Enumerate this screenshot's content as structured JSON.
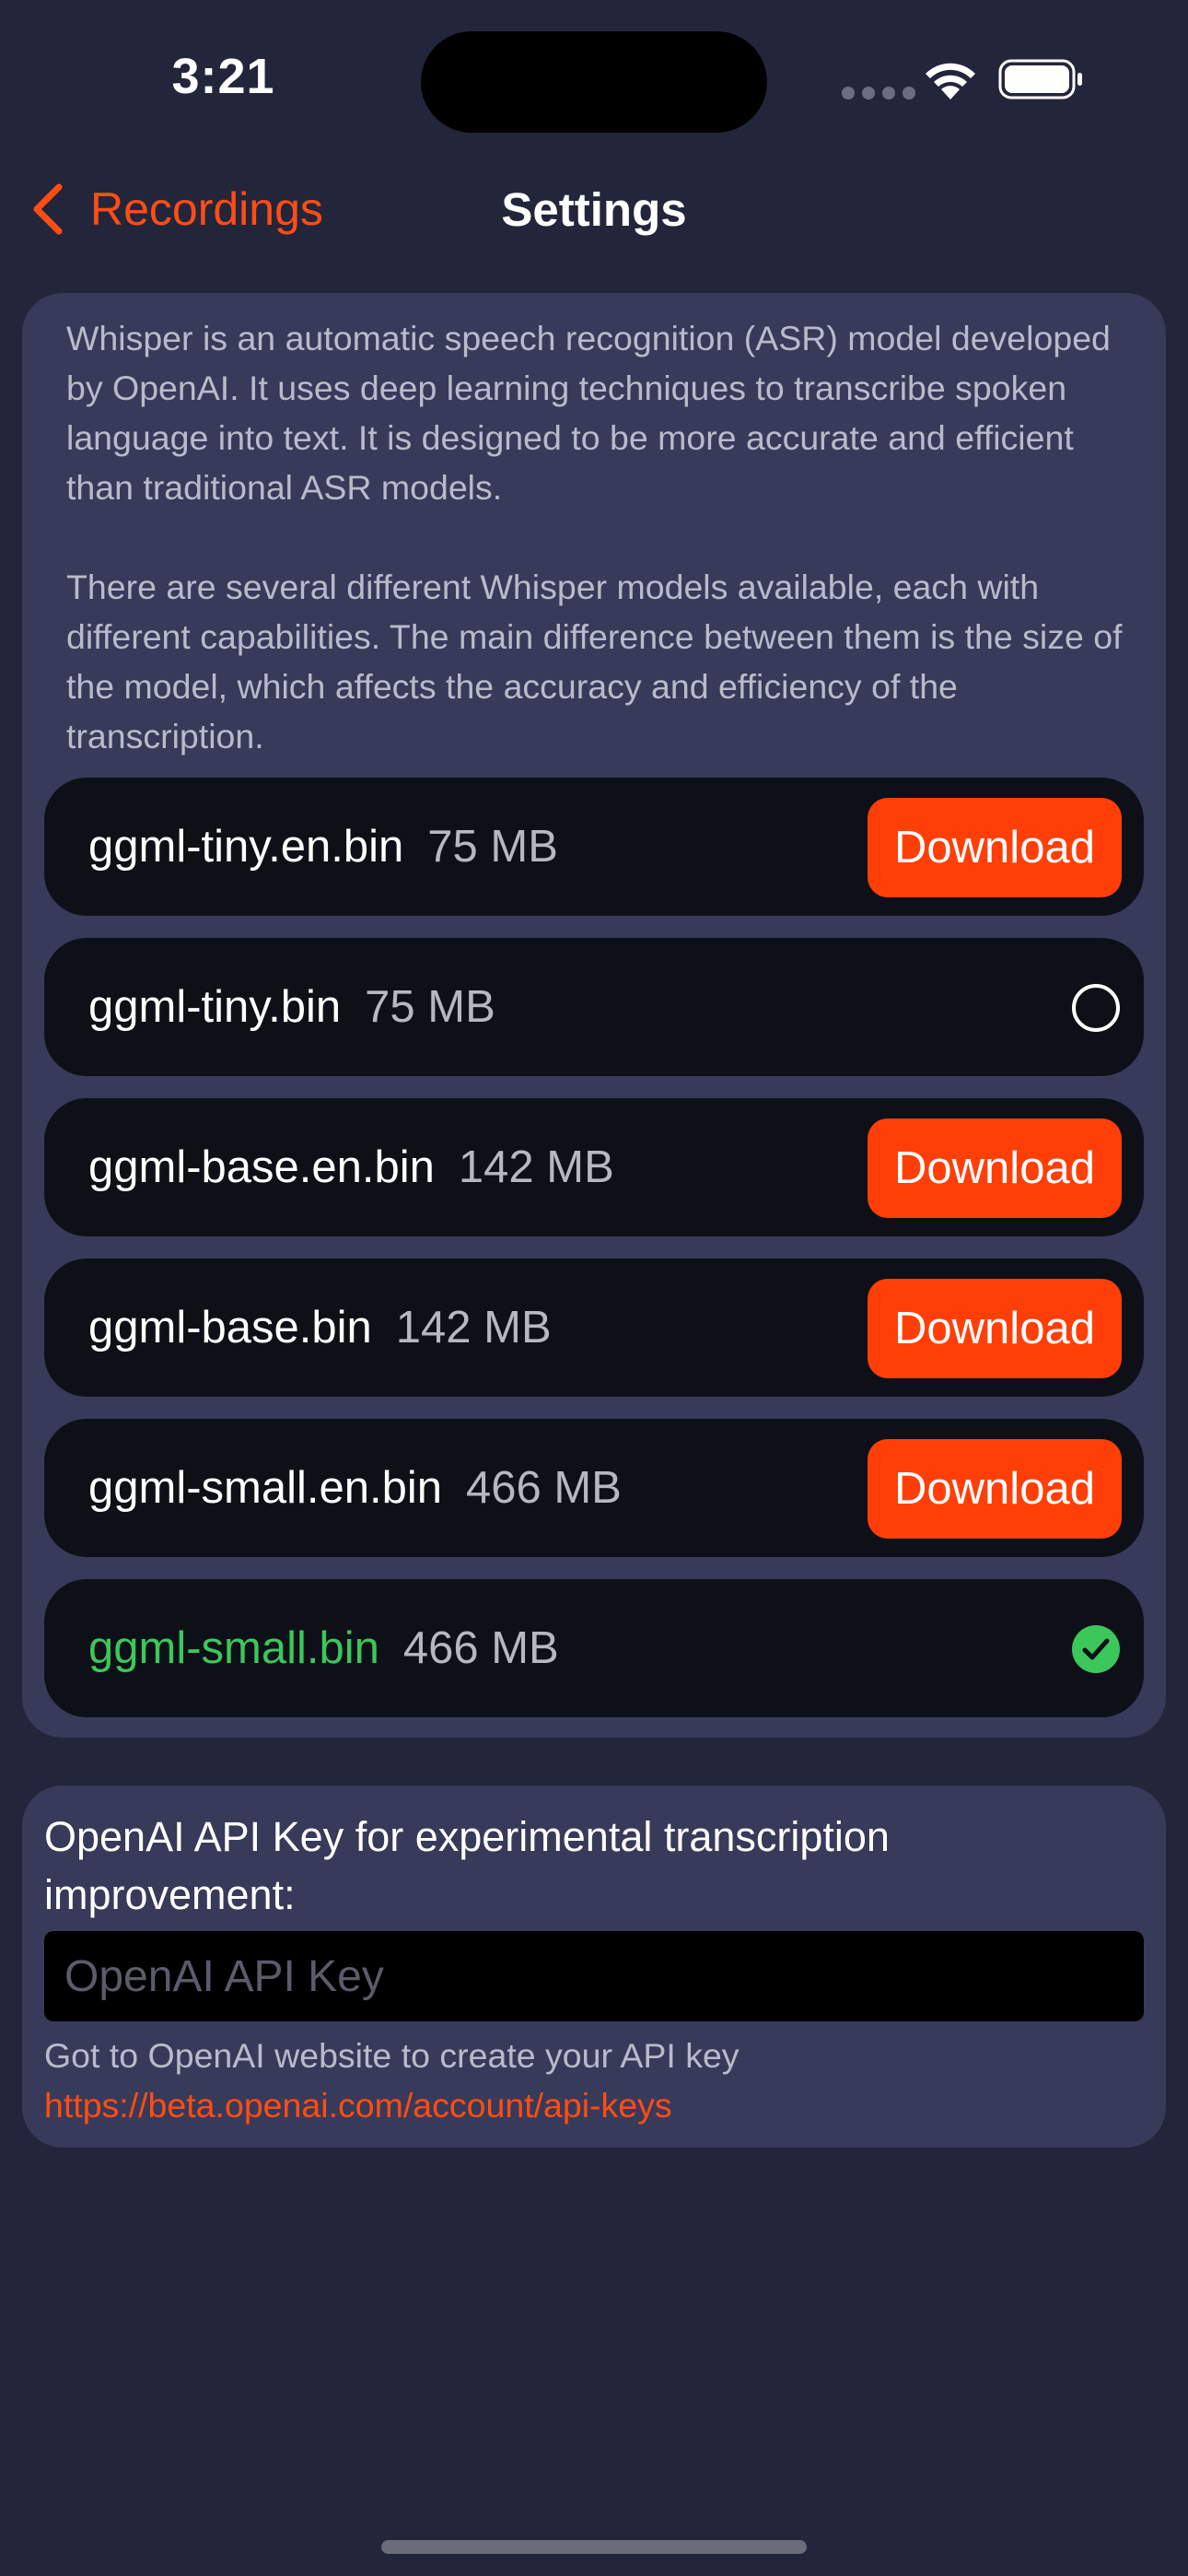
{
  "status_bar": {
    "time": "3:21",
    "icons": [
      "cellular-signal-icon",
      "wifi-icon",
      "battery-icon"
    ]
  },
  "nav": {
    "back_label": "Recordings",
    "title": "Settings"
  },
  "models_section": {
    "description_paragraphs": [
      "Whisper is an automatic speech recognition (ASR) model developed by OpenAI. It uses deep learning techniques to transcribe spoken language into text. It is designed to be more accurate and efficient than traditional ASR models.",
      "There are several different Whisper models available, each with different capabilities. The main difference between them is the size of the model, which affects the accuracy and efficiency of the transcription."
    ],
    "models": [
      {
        "name": "ggml-tiny.en.bin",
        "size": "75 MB",
        "state": "download",
        "action_label": "Download"
      },
      {
        "name": "ggml-tiny.bin",
        "size": "75 MB",
        "state": "downloaded",
        "action_label": ""
      },
      {
        "name": "ggml-base.en.bin",
        "size": "142 MB",
        "state": "download",
        "action_label": "Download"
      },
      {
        "name": "ggml-base.bin",
        "size": "142 MB",
        "state": "download",
        "action_label": "Download"
      },
      {
        "name": "ggml-small.en.bin",
        "size": "466 MB",
        "state": "download",
        "action_label": "Download"
      },
      {
        "name": "ggml-small.bin",
        "size": "466 MB",
        "state": "selected",
        "action_label": ""
      }
    ]
  },
  "api_section": {
    "label": "OpenAI API Key for experimental transcription improvement:",
    "input_placeholder": "OpenAI API Key",
    "input_value": "",
    "help_text": "Got to OpenAI website to create your API key ",
    "help_link": "https://beta.openai.com/account/api-keys"
  },
  "colors": {
    "background": "#23263a",
    "card": "#383a5a",
    "row": "#0e1018",
    "accent": "#ff3f07",
    "selected_green": "#3cc75a"
  }
}
